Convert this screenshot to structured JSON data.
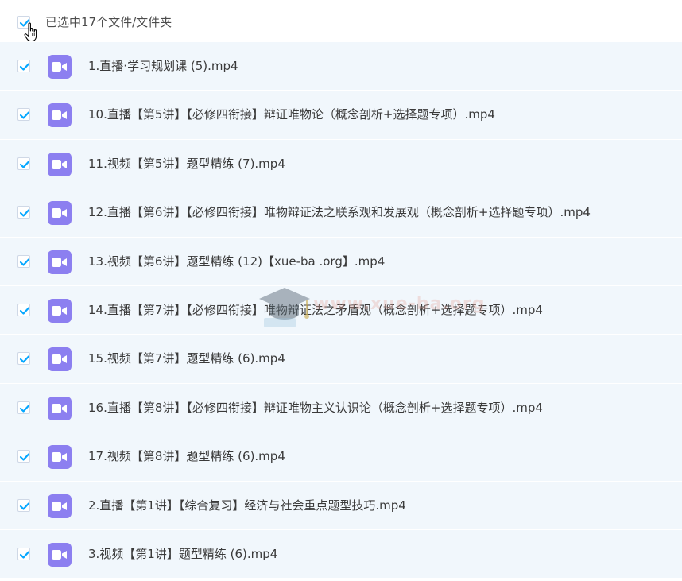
{
  "header": {
    "selection_label": "已选中17个文件/文件夹",
    "all_checked": true
  },
  "files": [
    {
      "name": "1.直播·学习规划课 (5).mp4",
      "checked": true,
      "icon": "video-file-icon"
    },
    {
      "name": "10.直播【第5讲】【必修四衔接】辩证唯物论（概念剖析+选择题专项）.mp4",
      "checked": true,
      "icon": "video-file-icon"
    },
    {
      "name": "11.视频【第5讲】题型精练 (7).mp4",
      "checked": true,
      "icon": "video-file-icon"
    },
    {
      "name": "12.直播【第6讲】【必修四衔接】唯物辩证法之联系观和发展观（概念剖析+选择题专项）.mp4",
      "checked": true,
      "icon": "video-file-icon"
    },
    {
      "name": "13.视频【第6讲】题型精练 (12)【xue-ba .org】.mp4",
      "checked": true,
      "icon": "video-file-icon"
    },
    {
      "name": "14.直播【第7讲】【必修四衔接】唯物辩证法之矛盾观（概念剖析+选择题专项）.mp4",
      "checked": true,
      "icon": "video-file-icon"
    },
    {
      "name": "15.视频【第7讲】题型精练 (6).mp4",
      "checked": true,
      "icon": "video-file-icon"
    },
    {
      "name": "16.直播【第8讲】【必修四衔接】辩证唯物主义认识论（概念剖析+选择题专项）.mp4",
      "checked": true,
      "icon": "video-file-icon"
    },
    {
      "name": "17.视频【第8讲】题型精练 (6).mp4",
      "checked": true,
      "icon": "video-file-icon"
    },
    {
      "name": "2.直播【第1讲】【综合复习】经济与社会重点题型技巧.mp4",
      "checked": true,
      "icon": "video-file-icon"
    },
    {
      "name": "3.视频【第1讲】题型精练 (6).mp4",
      "checked": true,
      "icon": "video-file-icon"
    }
  ],
  "watermark": {
    "text": "www.xue-ba.org"
  },
  "colors": {
    "accent": "#06a7ff",
    "row_bg": "#f1f7fc",
    "icon_bg": "#8c7ff0"
  }
}
